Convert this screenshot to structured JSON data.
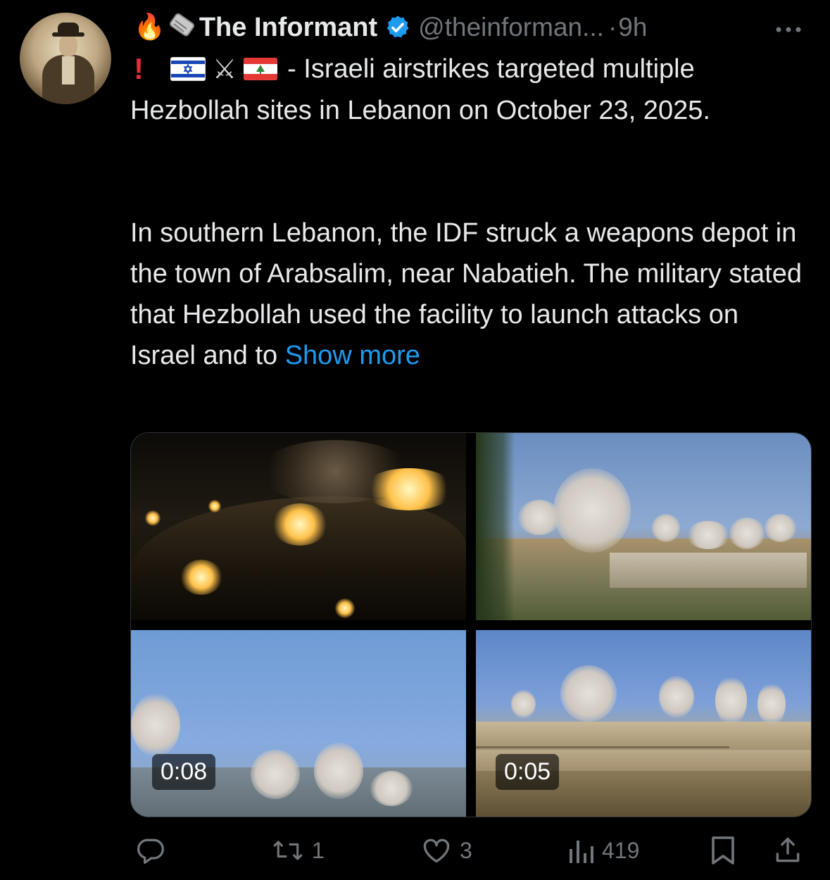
{
  "author": {
    "display_name": "The Informant",
    "handle": "@theinforman...",
    "time_separator": "·",
    "time_ago": "9h",
    "name_emojis": [
      "fire",
      "newspaper-roll"
    ],
    "verified_color": "#1d9bf0"
  },
  "tweet": {
    "line1_prefix_icons": [
      "red-exclamation",
      "israel-flag",
      "crossed-swords",
      "lebanon-flag"
    ],
    "line1_text": "- Israeli airstrikes targeted multiple",
    "paragraph1_rest": "Hezbollah sites in Lebanon on October 23, 2025.",
    "paragraph2": "In southern Lebanon, the IDF struck a weapons depot in the town of Arabsalim, near Nabatieh. The military stated that Hezbollah used the facility to launch attacks on Israel and to",
    "show_more": "Show more",
    "link_color": "#1d9bf0"
  },
  "media": {
    "tiles": [
      {
        "description_icon": "night-fire-video"
      },
      {
        "description_icon": "smoke-plumes-video"
      },
      {
        "description_icon": "smoke-plumes-video",
        "duration": "0:08"
      },
      {
        "description_icon": "smoke-plumes-video",
        "duration": "0:05"
      }
    ]
  },
  "actions": {
    "reply_count": "",
    "retweet_count": "1",
    "like_count": "3",
    "views_count": "419"
  },
  "menu_icon": "more-dots-icon"
}
